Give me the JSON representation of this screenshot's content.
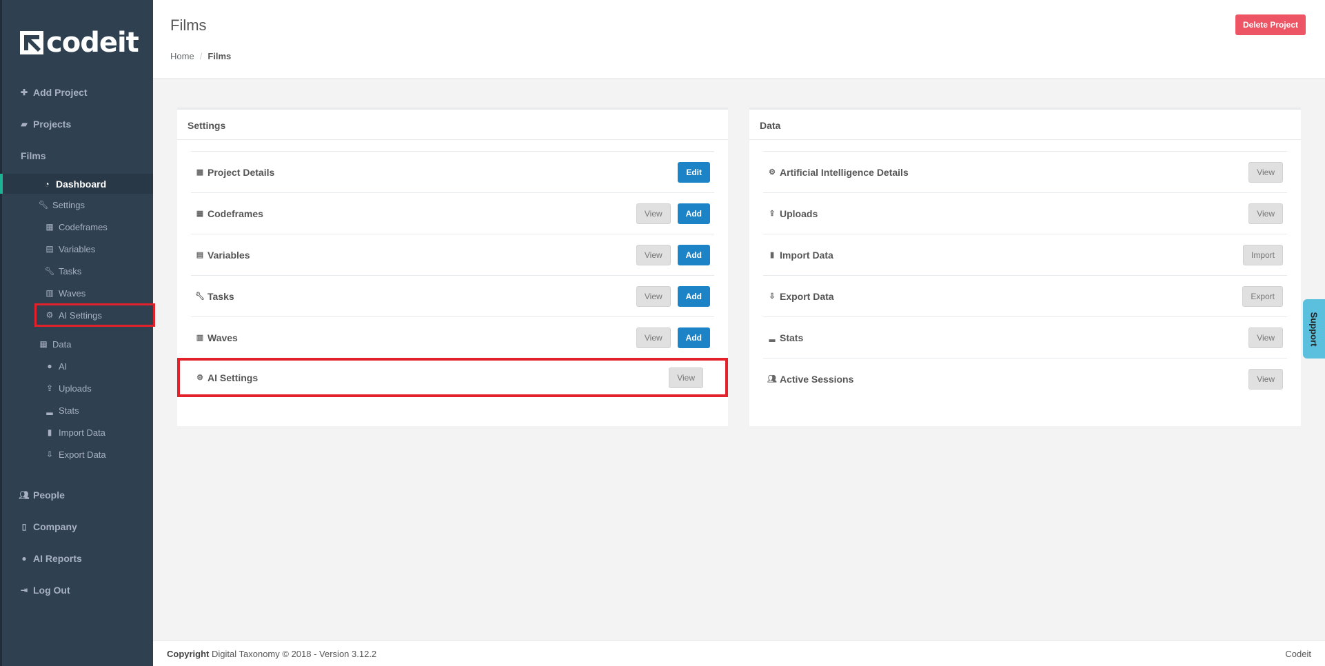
{
  "logo": {
    "text": "codeit"
  },
  "sidebar": {
    "top_items": [
      {
        "label": "Add Project",
        "icon": "plus-icon"
      },
      {
        "label": "Projects",
        "icon": "briefcase-icon"
      },
      {
        "label": "Films"
      }
    ],
    "dashboard": {
      "label": "Dashboard",
      "icon": "dashboard-icon"
    },
    "settings": {
      "label": "Settings",
      "icon": "wrench-icon"
    },
    "settings_children": [
      {
        "label": "Codeframes",
        "icon": "table-icon"
      },
      {
        "label": "Variables",
        "icon": "calculator-icon"
      },
      {
        "label": "Tasks",
        "icon": "wrench-icon"
      },
      {
        "label": "Waves",
        "icon": "calendar-icon"
      },
      {
        "label": "AI Settings",
        "icon": "cogs-icon"
      }
    ],
    "data": {
      "label": "Data",
      "icon": "table-icon"
    },
    "data_children": [
      {
        "label": "AI",
        "icon": "android-icon"
      },
      {
        "label": "Uploads",
        "icon": "upload-icon"
      },
      {
        "label": "Stats",
        "icon": "signal-icon"
      },
      {
        "label": "Import Data",
        "icon": "file-icon"
      },
      {
        "label": "Export Data",
        "icon": "download-icon"
      }
    ],
    "bottom_items": [
      {
        "label": "People",
        "icon": "users-icon"
      },
      {
        "label": "Company",
        "icon": "building-icon"
      },
      {
        "label": "AI Reports",
        "icon": "android-icon"
      },
      {
        "label": "Log Out",
        "icon": "sign-out-icon"
      }
    ]
  },
  "header": {
    "title": "Films",
    "breadcrumb": {
      "home": "Home",
      "separator": "/",
      "current": "Films"
    },
    "delete_label": "Delete Project"
  },
  "settings_panel": {
    "title": "Settings",
    "rows": [
      {
        "label": "Project Details",
        "icon": "table-icon",
        "buttons": [
          "Edit"
        ]
      },
      {
        "label": "Codeframes",
        "icon": "table-icon",
        "buttons": [
          "View",
          "Add"
        ]
      },
      {
        "label": "Variables",
        "icon": "calculator-icon",
        "buttons": [
          "View",
          "Add"
        ]
      },
      {
        "label": "Tasks",
        "icon": "wrench-icon",
        "buttons": [
          "View",
          "Add"
        ]
      },
      {
        "label": "Waves",
        "icon": "calendar-icon",
        "buttons": [
          "View",
          "Add"
        ]
      },
      {
        "label": "AI Settings",
        "icon": "cogs-icon",
        "buttons": [
          "View"
        ]
      }
    ]
  },
  "data_panel": {
    "title": "Data",
    "rows": [
      {
        "label": "Artificial Intelligence Details",
        "icon": "cogs-icon",
        "button": "View"
      },
      {
        "label": "Uploads",
        "icon": "upload-icon",
        "button": "View"
      },
      {
        "label": "Import Data",
        "icon": "file-icon",
        "button": "Import"
      },
      {
        "label": "Export Data",
        "icon": "download-icon",
        "button": "Export"
      },
      {
        "label": "Stats",
        "icon": "signal-icon",
        "button": "View"
      },
      {
        "label": "Active Sessions",
        "icon": "users-icon",
        "button": "View"
      }
    ]
  },
  "support": {
    "label": "Support"
  },
  "footer": {
    "copyright_label": "Copyright",
    "copyright_text": "Digital Taxonomy © 2018 - Version 3.12.2",
    "brand": "Codeit"
  },
  "colors": {
    "sidebar_bg": "#2f4050",
    "primary": "#1c84c6",
    "danger": "#ed5565",
    "highlight": "#e3212a",
    "support": "#5bc0de"
  }
}
